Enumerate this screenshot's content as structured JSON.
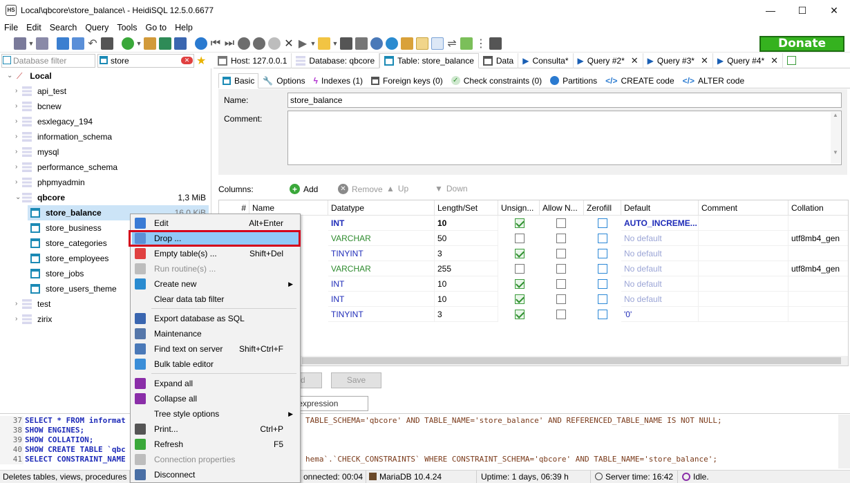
{
  "window": {
    "title": "Local\\qbcore\\store_balance\\ - HeidiSQL 12.5.0.6677",
    "logo_text": "HS",
    "minimize": "—",
    "maximize": "☐",
    "close": "✕"
  },
  "menu": [
    "File",
    "Edit",
    "Search",
    "Query",
    "Tools",
    "Go to",
    "Help"
  ],
  "donate": "Donate",
  "filters": {
    "database_placeholder": "Database filter",
    "table_value": "store"
  },
  "tree": {
    "root": "Local",
    "databases": [
      {
        "name": "api_test"
      },
      {
        "name": "bcnew"
      },
      {
        "name": "esxlegacy_194"
      },
      {
        "name": "information_schema"
      },
      {
        "name": "mysql"
      },
      {
        "name": "performance_schema"
      },
      {
        "name": "phpmyadmin"
      },
      {
        "name": "qbcore",
        "size": "1,3 MiB"
      }
    ],
    "tables": [
      {
        "name": "store_balance",
        "size": "16,0 KiB"
      },
      {
        "name": "store_business"
      },
      {
        "name": "store_categories"
      },
      {
        "name": "store_employees"
      },
      {
        "name": "store_jobs"
      },
      {
        "name": "store_users_theme"
      }
    ],
    "after": [
      {
        "name": "test"
      },
      {
        "name": "zirix"
      }
    ]
  },
  "tabs": [
    {
      "label": "Host: 127.0.0.1"
    },
    {
      "label": "Database: qbcore"
    },
    {
      "label": "Table: store_balance"
    },
    {
      "label": "Data"
    },
    {
      "label": "Consulta*"
    },
    {
      "label": "Query #2*"
    },
    {
      "label": "Query #3*"
    },
    {
      "label": "Query #4*"
    }
  ],
  "subtabs": [
    {
      "label": "Basic"
    },
    {
      "label": "Options"
    },
    {
      "label": "Indexes (1)"
    },
    {
      "label": "Foreign keys (0)"
    },
    {
      "label": "Check constraints (0)"
    },
    {
      "label": "Partitions"
    },
    {
      "label": "CREATE code"
    },
    {
      "label": "ALTER code"
    }
  ],
  "editor": {
    "name_label": "Name:",
    "name_value": "store_balance",
    "comment_label": "Comment:"
  },
  "columns_bar": {
    "label": "Columns:",
    "add": "Add",
    "remove": "Remove",
    "up": "Up",
    "down": "Down"
  },
  "grid": {
    "headers": [
      "#",
      "Name",
      "Datatype",
      "Length/Set",
      "Unsign...",
      "Allow N...",
      "Zerofill",
      "Default",
      "Comment",
      "Collation"
    ],
    "rows": [
      {
        "datatype": "INT",
        "length": "10",
        "default": "AUTO_INCREME...",
        "collation": "",
        "unsigned": true,
        "allownull": false
      },
      {
        "datatype": "VARCHAR",
        "length": "50",
        "default": "No default",
        "collation": "utf8mb4_gen",
        "unsigned": false,
        "allownull": false
      },
      {
        "datatype": "TINYINT",
        "length": "3",
        "default": "No default",
        "collation": "",
        "unsigned": true,
        "allownull": false
      },
      {
        "datatype": "VARCHAR",
        "length": "255",
        "default": "No default",
        "collation": "utf8mb4_gen",
        "unsigned": false,
        "allownull": false
      },
      {
        "datatype": "INT",
        "length": "10",
        "default": "No default",
        "collation": "",
        "unsigned": true,
        "allownull": false
      },
      {
        "datatype": "INT",
        "length": "10",
        "default": "No default",
        "collation": "",
        "unsigned": true,
        "allownull": false
      },
      {
        "datatype": "TINYINT",
        "length": "3",
        "default": "'0'",
        "collation": "",
        "unsigned": true,
        "allownull": false
      }
    ]
  },
  "buttons": {
    "discard_fragment": "ard",
    "save": "Save"
  },
  "filter_expression": "r expression",
  "sqllog": [
    {
      "no": "37",
      "left": "SELECT * FROM informat",
      "right": "TABLE_SCHEMA='qbcore'   AND TABLE_NAME='store_balance'   AND REFERENCED_TABLE_NAME IS NOT NULL;"
    },
    {
      "no": "38",
      "left": "SHOW ENGINES;",
      "right": ""
    },
    {
      "no": "39",
      "left": "SHOW COLLATION;",
      "right": ""
    },
    {
      "no": "40",
      "left": "SHOW CREATE TABLE `qbc",
      "right": ""
    },
    {
      "no": "41",
      "left": "SELECT CONSTRAINT_NAME",
      "right": "hema`.`CHECK_CONSTRAINTS` WHERE CONSTRAINT_SCHEMA='qbcore' AND TABLE_NAME='store_balance';"
    }
  ],
  "status": {
    "hint": "Deletes tables, views, procedures ar",
    "connected": "onnected: 00:04 h",
    "server": "MariaDB 10.4.24",
    "uptime": "Uptime: 1 days, 06:39 h",
    "servertime": "Server time: 16:42",
    "state": "Idle."
  },
  "context_menu": [
    {
      "label": "Edit",
      "shortcut": "Alt+Enter",
      "icon": "edit-icon",
      "color": "#3a7bd5"
    },
    {
      "label": "Drop ...",
      "shortcut": "",
      "icon": "drop-icon",
      "color": "#5b8fd6",
      "highlighted": true
    },
    {
      "label": "Empty table(s) ...",
      "shortcut": "Shift+Del",
      "icon": "empty-icon",
      "color": "#e04040"
    },
    {
      "label": "Run routine(s) ...",
      "shortcut": "",
      "icon": "run-icon",
      "color": "#bdbdbd",
      "disabled": true
    },
    {
      "label": "Create new",
      "shortcut": "",
      "icon": "create-icon",
      "color": "#2a8bd0",
      "submenu": true
    },
    {
      "label": "Clear data tab filter",
      "shortcut": "",
      "icon": "",
      "color": ""
    },
    {
      "label": "Export database as SQL",
      "shortcut": "",
      "icon": "export-icon",
      "color": "#3a66b0",
      "sep_before": true
    },
    {
      "label": "Maintenance",
      "shortcut": "",
      "icon": "wrench-icon",
      "color": "#5577aa"
    },
    {
      "label": "Find text on server",
      "shortcut": "Shift+Ctrl+F",
      "icon": "find-icon",
      "color": "#4a79b8"
    },
    {
      "label": "Bulk table editor",
      "shortcut": "",
      "icon": "bulk-icon",
      "color": "#3b8ed8"
    },
    {
      "label": "Expand all",
      "shortcut": "",
      "icon": "expand-icon",
      "color": "#8a2ea8",
      "sep_before": true
    },
    {
      "label": "Collapse all",
      "shortcut": "",
      "icon": "collapse-icon",
      "color": "#8a2ea8"
    },
    {
      "label": "Tree style options",
      "shortcut": "",
      "icon": "",
      "color": "",
      "submenu": true
    },
    {
      "label": "Print...",
      "shortcut": "Ctrl+P",
      "icon": "print-icon",
      "color": "#555"
    },
    {
      "label": "Refresh",
      "shortcut": "F5",
      "icon": "refresh-icon",
      "color": "#3aa83a"
    },
    {
      "label": "Connection properties",
      "shortcut": "",
      "icon": "conn-icon",
      "color": "#bdbdbd",
      "disabled": true
    },
    {
      "label": "Disconnect",
      "shortcut": "",
      "icon": "disconnect-icon",
      "color": "#4a6fa5"
    }
  ]
}
